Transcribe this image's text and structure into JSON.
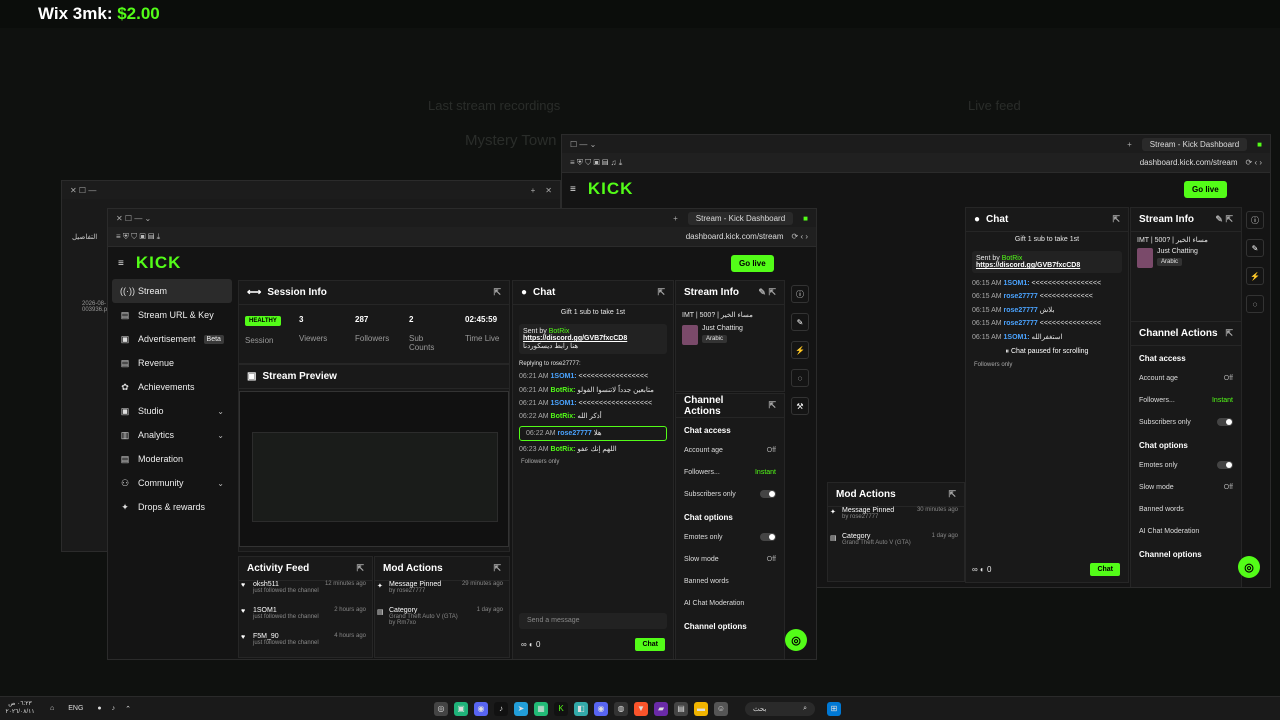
{
  "overlay": {
    "label": "Wix 3mk:",
    "price": "$2.00"
  },
  "background": {
    "ghost_texts": [
      "Last stream recordings",
      "Mystery Town",
      "Live feed"
    ]
  },
  "front_window": {
    "tab_title": "Stream - Kick Dashboard",
    "url": "dashboard.kick.com/stream",
    "logo": "KICK",
    "go_live": "Go live",
    "sidebar": [
      {
        "label": "Stream",
        "icon": "((·))"
      },
      {
        "label": "Stream URL & Key",
        "icon": "▤"
      },
      {
        "label": "Advertisement",
        "icon": "▣",
        "badge": "Beta"
      },
      {
        "label": "Revenue",
        "icon": "▤"
      },
      {
        "label": "Achievements",
        "icon": "✿"
      },
      {
        "label": "Studio",
        "icon": "▣",
        "chevron": "⌄"
      },
      {
        "label": "Analytics",
        "icon": "▥",
        "chevron": "⌄"
      },
      {
        "label": "Moderation",
        "icon": "▤"
      },
      {
        "label": "Community",
        "icon": "⚇",
        "chevron": "⌄"
      },
      {
        "label": "Drops & rewards",
        "icon": "✦"
      }
    ],
    "session": {
      "title": "Session Info",
      "status": "HEALTHY",
      "status_label": "Session",
      "viewers": "3",
      "viewers_label": "Viewers",
      "followers": "287",
      "followers_label": "Followers",
      "subs": "2",
      "subs_label": "Sub Counts",
      "time": "02:45:59",
      "time_label": "Time Live"
    },
    "preview_title": "Stream Preview",
    "activity": {
      "title": "Activity Feed",
      "rows": [
        {
          "user": "oksh511",
          "text": "just followed the channel",
          "time": "12 minutes ago"
        },
        {
          "user": "1SOM1",
          "text": "just followed the channel",
          "time": "2 hours ago"
        },
        {
          "user": "F5M_90",
          "text": "just followed the channel",
          "time": "4 hours ago"
        }
      ]
    },
    "mod_actions": {
      "title": "Mod Actions",
      "rows": [
        {
          "action": "Message Pinned",
          "by": "by rose27777",
          "time": "29 minutes ago"
        },
        {
          "action": "Category",
          "detail": "Grand Theft Auto V (GTA)",
          "by": "by Rm7xo",
          "time": "1 day ago"
        }
      ]
    },
    "chat": {
      "title": "Chat",
      "gift_banner": "Gift 1 sub to take 1st",
      "pinned_sent_by": "Sent by",
      "pinned_user": "BotRix",
      "pinned_link": "https://discord.gg/GVB7fxcCD8",
      "pinned_text": "هنا رابط ديسكوردنا",
      "reply_note": "Replying to rose27777:",
      "lines": [
        {
          "time": "06:21 AM",
          "user": "1SOM1:",
          "text": "<<<<<<<<<<<<<<<<<"
        },
        {
          "time": "06:21 AM",
          "user": "BotRix:",
          "text": "متابعين جدداً لاتنسوا الفولو"
        },
        {
          "time": "06:21 AM",
          "user": "1SOM1:",
          "text": "<<<<<<<<<<<<<<<<<<"
        },
        {
          "time": "06:22 AM",
          "user": "BotRix:",
          "text": "أذكر الله"
        },
        {
          "time": "06:22 AM",
          "user": "rose27777",
          "text": "هلا"
        },
        {
          "time": "06:23 AM",
          "user": "BotRix:",
          "text": "اللهم إنك عفو"
        }
      ],
      "followers_only": "Followers only",
      "input_placeholder": "Send a message",
      "count": "0",
      "send": "Chat"
    },
    "stream_info": {
      "title": "Stream Info",
      "name": "IMT | 500? | مساء الخير",
      "category": "Just Chatting",
      "language": "Arabic"
    },
    "channel_actions": {
      "title": "Channel Actions",
      "access_title": "Chat access",
      "account_age": "Account age",
      "account_age_val": "Off",
      "followers": "Followers...",
      "followers_val": "Instant",
      "subscribers_only": "Subscribers only",
      "options_title": "Chat options",
      "emotes_only": "Emotes only",
      "slow_mode": "Slow mode",
      "slow_mode_val": "Off",
      "banned_words": "Banned words",
      "ai_mod": "AI Chat Moderation",
      "channel_options": "Channel options"
    }
  },
  "back_window": {
    "tab_title": "Stream - Kick Dashboard",
    "url": "dashboard.kick.com/stream",
    "logo": "KICK",
    "go_live": "Go live",
    "chat": {
      "title": "Chat",
      "gift_banner": "Gift 1 sub to take 1st",
      "pinned_sent_by": "Sent by",
      "pinned_user": "BotRix",
      "pinned_link": "https://discord.gg/GVB7fxcCD8",
      "lines": [
        {
          "time": "06:15 AM",
          "user": "1SOM1:",
          "text": "<<<<<<<<<<<<<<<<<"
        },
        {
          "time": "06:15 AM",
          "user": "rose27777",
          "text": "<<<<<<<<<<<<<"
        },
        {
          "time": "06:15 AM",
          "user": "rose27777",
          "text": "بلاش"
        },
        {
          "time": "06:15 AM",
          "user": "rose27777",
          "text": "<<<<<<<<<<<<<<<"
        },
        {
          "time": "06:15 AM",
          "user": "1SOM1:",
          "text": "استغفرالله"
        }
      ],
      "paused": "Chat paused for scrolling",
      "followers_only": "Followers only",
      "count": "0",
      "send": "Chat"
    },
    "stream_info": {
      "title": "Stream Info",
      "name": "IMT | 500? | مساء الخير",
      "category": "Just Chatting",
      "language": "Arabic"
    },
    "channel_actions": {
      "title": "Channel Actions",
      "access_title": "Chat access",
      "account_age": "Account age",
      "account_age_val": "Off",
      "followers": "Followers...",
      "followers_val": "Instant",
      "subscribers_only": "Subscribers only",
      "options_title": "Chat options",
      "emotes_only": "Emotes only",
      "slow_mode": "Slow mode",
      "slow_mode_val": "Off",
      "banned_words": "Banned words",
      "ai_mod": "AI Chat Moderation",
      "channel_options": "Channel options"
    },
    "mod_actions": {
      "title": "Mod Actions",
      "rows": [
        {
          "action": "Message Pinned",
          "by": "by rose27777",
          "time": "30 minutes ago"
        },
        {
          "action": "Category",
          "detail": "Grand Theft Auto V (GTA)",
          "by": "by Rm7xo",
          "time": "1 day ago"
        }
      ]
    }
  },
  "left_window": {
    "label": "التفاصيل",
    "file_text": "2026-08-003936.pn"
  },
  "taskbar": {
    "time": "٠٦:٢٣ ص",
    "date": "٢٠٢٦/٠٨/١١",
    "lang": "ENG",
    "search": "بحث"
  },
  "colors": {
    "accent": "#53fc18",
    "bg": "#0b0d0b",
    "panel": "#191919"
  }
}
